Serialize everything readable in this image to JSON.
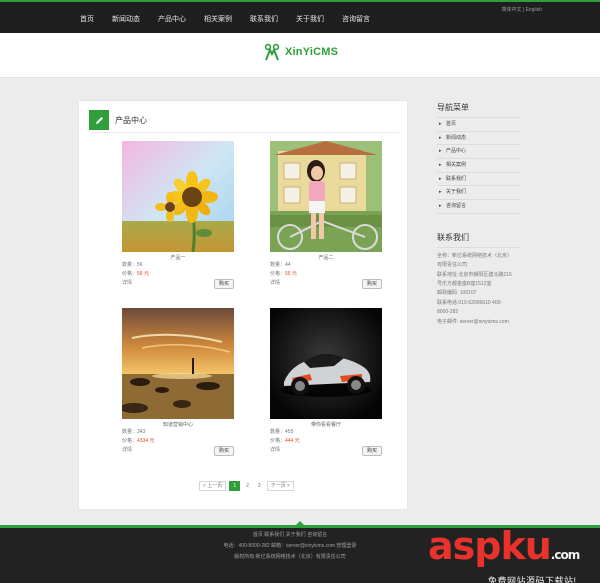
{
  "top_nav": [
    "首页",
    "新闻动态",
    "产品中心",
    "相关案例",
    "联系我们",
    "关于我们",
    "咨询留言"
  ],
  "top_lang": {
    "cn": "简体中文",
    "sep": "|",
    "en": "English"
  },
  "logo": {
    "text": "XinYiCMS"
  },
  "main": {
    "title": "产品中心",
    "products": [
      {
        "name": "产品一",
        "qty_label": "数量：",
        "qty": "56",
        "price_label": "价格：",
        "price": "56 元",
        "detail": "详情",
        "buy": "购买"
      },
      {
        "name": "产品二",
        "qty_label": "数量：",
        "qty": "44",
        "price_label": "价格：",
        "price": "55 元",
        "detail": "详情",
        "buy": "购买"
      },
      {
        "name": "知道营销中心",
        "qty_label": "数量：",
        "qty": "343",
        "price_label": "价格：",
        "price": "4334 元",
        "detail": "详情",
        "buy": "购买"
      },
      {
        "name": "带你看看餐厅",
        "qty_label": "数量：",
        "qty": "455",
        "price_label": "价格：",
        "price": "444 元",
        "detail": "详情",
        "buy": "购买"
      }
    ],
    "pager": {
      "prev": "< 上一页",
      "pages": [
        "1",
        "2",
        "3"
      ],
      "next": "下一页 >"
    }
  },
  "sidebar": {
    "nav_title": "导航菜单",
    "nav_items": [
      "首页",
      "新闻动态",
      "产品中心",
      "相关案例",
      "联系我们",
      "关于我们",
      "咨询留言"
    ],
    "contact_title": "联系我们",
    "contact_lines": [
      "全称：新亿系统网络技术（北京）",
      "有限责任公司",
      "联系地址:北京市朝阳区建北路216",
      "号乐方都金座B座1512室",
      "邮政编码: 100107",
      "联系电话:010-52006610 400-",
      "8000-282",
      "电子邮件: server@xinyicms.com"
    ]
  },
  "footer": {
    "line1": "首页  联系我们  关于我们  咨询留言",
    "line2": "电话：400-8000-282    邮箱：server@xinyicms.com   管理登录",
    "line3": "版权所有:新亿系统网络技术（北京）有限责任公司"
  },
  "watermark": {
    "asp": "asp",
    "ku": "ku",
    "com": ".com",
    "sub": "免费网站源码下载站!"
  },
  "colors": {
    "accent": "#2f9f3c",
    "price": "#e0491c",
    "topbar": "#1f1f1f",
    "footer": "#222222"
  }
}
